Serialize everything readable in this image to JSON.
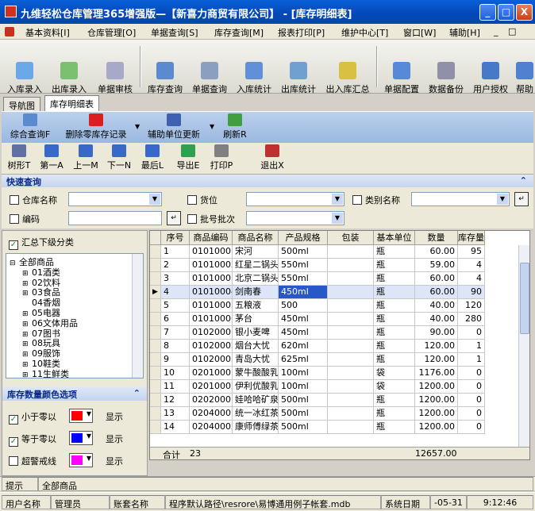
{
  "window": {
    "title": "九维轻松仓库管理365增强版—【新喜力商贸有限公司】 - [库存明细表]",
    "min_label": "_",
    "max_label": "□",
    "close_label": "X"
  },
  "menu": {
    "items": [
      "基本资料[I]",
      "仓库管理[O]",
      "单据查询[S]",
      "库存查询[M]",
      "报表打印[P]",
      "维护中心[T]",
      "窗口[W]",
      "辅助[H]"
    ],
    "mdi_min": "_",
    "mdi_restore": "□",
    "mdi_close": "×"
  },
  "toolbar": {
    "buttons": [
      "入库录入",
      "出库录入",
      "单据审核",
      "库存查询",
      "单据查询",
      "入库统计",
      "出库统计",
      "出入库汇总",
      "单据配置",
      "数据备份",
      "用户授权",
      "帮助"
    ]
  },
  "tabs": [
    "导航图",
    "库存明细表"
  ],
  "actions": {
    "buttons": [
      "综合查询F",
      "删除零库存记录",
      "辅助单位更新",
      "刷新R"
    ]
  },
  "nav": {
    "buttons": [
      "树形T",
      "第一A",
      "上一M",
      "下一N",
      "最后L",
      "导出E",
      "打印P",
      "退出X"
    ]
  },
  "quick": {
    "header": "快速查询",
    "collapse": "⌃",
    "warehouse_label": "仓库名称",
    "slot_label": "货位",
    "category_label": "类别名称",
    "code_label": "编码",
    "batch_label": "批号批次",
    "search_btn": "↵"
  },
  "left": {
    "summary_label": "汇总下级分类",
    "summary_checked": "✓",
    "tree": [
      {
        "label": "全部商品",
        "toggle": "⊟"
      },
      {
        "label": "01酒类",
        "toggle": "⊞"
      },
      {
        "label": "02饮料",
        "toggle": "⊞"
      },
      {
        "label": "03食品",
        "toggle": "⊞"
      },
      {
        "label": "04香烟",
        "toggle": ""
      },
      {
        "label": "05电器",
        "toggle": "⊞"
      },
      {
        "label": "06文体用品",
        "toggle": "⊞"
      },
      {
        "label": "07图书",
        "toggle": "⊞"
      },
      {
        "label": "08玩具",
        "toggle": "⊞"
      },
      {
        "label": "09服饰",
        "toggle": "⊞"
      },
      {
        "label": "10鞋类",
        "toggle": "⊞"
      },
      {
        "label": "11生鲜类",
        "toggle": "⊞"
      }
    ],
    "color_header": "库存数量颜色选项",
    "color_rows": [
      {
        "label": "小于零以",
        "checked": "✓",
        "color": "#ff0000",
        "show": "显示"
      },
      {
        "label": "等于零以",
        "checked": "✓",
        "color": "#0000ff",
        "show": "显示"
      },
      {
        "label": "超警戒线",
        "checked": "",
        "color": "#ff00ff",
        "show": "显示"
      }
    ]
  },
  "grid": {
    "columns": [
      "序号",
      "商品编码",
      "商品名称",
      "产品规格",
      "包装",
      "基本单位",
      "数量",
      "库存量"
    ],
    "rows": [
      [
        "1",
        "01010001",
        "宋河",
        "500ml",
        "",
        "瓶",
        "60.00",
        "95"
      ],
      [
        "2",
        "01010002",
        "红星二锅头",
        "550ml",
        "",
        "瓶",
        "59.00",
        "4"
      ],
      [
        "3",
        "01010003",
        "北京二锅头",
        "550ml",
        "",
        "瓶",
        "60.00",
        "4"
      ],
      [
        "4",
        "01010004",
        "剑南春",
        "450ml",
        "",
        "瓶",
        "60.00",
        "90"
      ],
      [
        "5",
        "01010005",
        "五粮液",
        "500",
        "",
        "瓶",
        "40.00",
        "120"
      ],
      [
        "6",
        "01010006",
        "茅台",
        "450ml",
        "",
        "瓶",
        "40.00",
        "280"
      ],
      [
        "7",
        "01020001",
        "银小麦啤",
        "450ml",
        "",
        "瓶",
        "90.00",
        "0"
      ],
      [
        "8",
        "01020002",
        "烟台大忧",
        "620ml",
        "",
        "瓶",
        "120.00",
        "1"
      ],
      [
        "9",
        "01020003",
        "青岛大忧",
        "625ml",
        "",
        "瓶",
        "120.00",
        "1"
      ],
      [
        "10",
        "02010001",
        "蒙牛酸酸乳",
        "100ml",
        "",
        "袋",
        "1176.00",
        "0"
      ],
      [
        "11",
        "02010002",
        "伊利优酸乳",
        "100ml",
        "",
        "袋",
        "1200.00",
        "0"
      ],
      [
        "12",
        "02020001",
        "娃哈哈矿泉水",
        "500ml",
        "",
        "瓶",
        "1200.00",
        "0"
      ],
      [
        "13",
        "02040001",
        "统一冰红茶",
        "500ml",
        "",
        "瓶",
        "1200.00",
        "0"
      ],
      [
        "14",
        "02040002",
        "康师傅绿茶",
        "500ml",
        "",
        "瓶",
        "1200.00",
        "0"
      ]
    ],
    "selected_index": 3,
    "row_pointer": "▶",
    "footer_label": "合计",
    "footer_count": "23",
    "footer_total": "12657.00"
  },
  "status": {
    "hint_label": "提示",
    "hint_value": "全部商品",
    "user_label": "用户名称",
    "user_value": "管理员",
    "account_label": "账套名称",
    "path_value": "程序默认路径\\resrore\\易博通用例子帐套.mdb",
    "date_label": "系统日期",
    "date_value": "-05-31",
    "time_value": "9:12:46"
  }
}
